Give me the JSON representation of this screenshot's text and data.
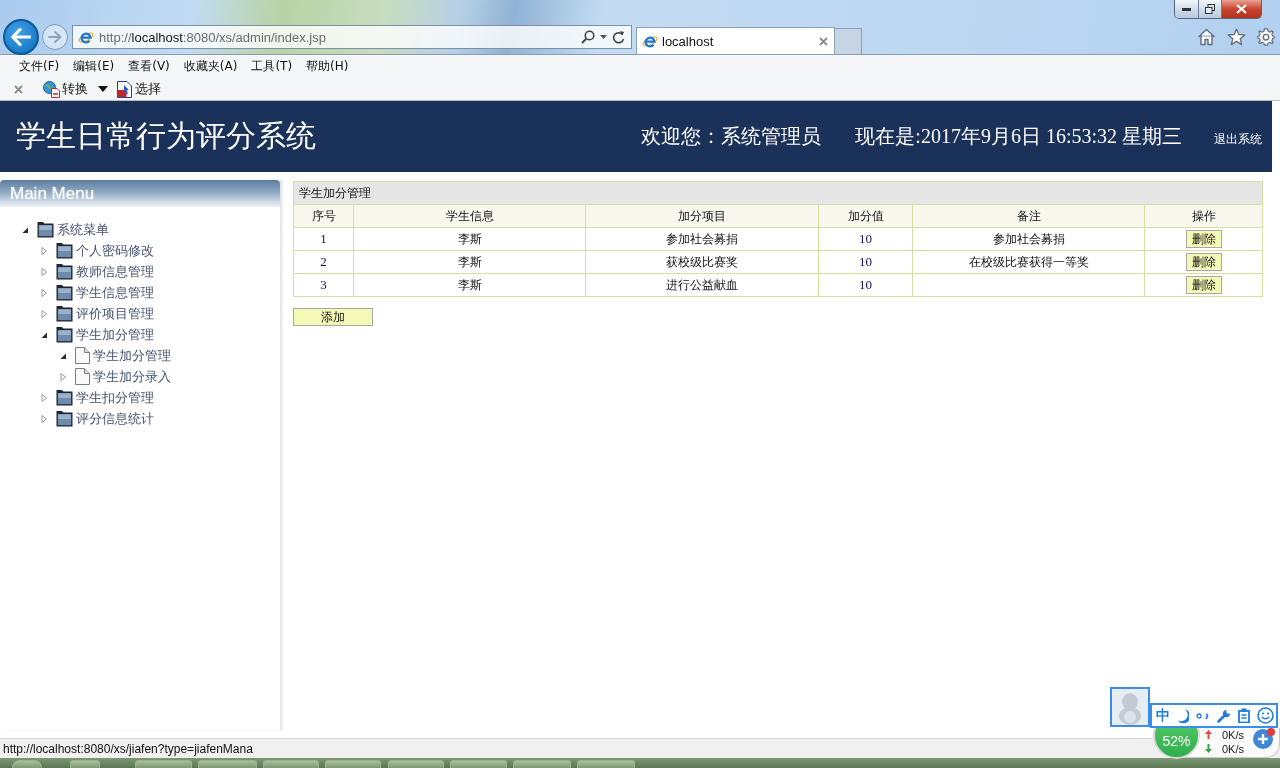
{
  "browser": {
    "address": "http://**localhost**:8080/xs/admin/index.jsp",
    "tabs": [
      {
        "title": "localhost",
        "selected": true
      }
    ],
    "menu": [
      "文件(F)",
      "编辑(E)",
      "查看(V)",
      "收藏夹(A)",
      "工具(T)",
      "帮助(H)"
    ],
    "toolbar": [
      {
        "kind": "convert",
        "label": "转换",
        "dropdown": true
      },
      {
        "kind": "select",
        "label": "选择",
        "dropdown": false
      }
    ]
  },
  "header": {
    "title": "学生日常行为评分系统",
    "welcome": "欢迎您：系统管理员",
    "datetime": "现在是:2017年9月6日 16:53:32 星期三",
    "logout": "退出系统"
  },
  "sidebar": {
    "title": "Main Menu",
    "tree": [
      {
        "label": "系统菜单",
        "kind": "folder",
        "expanded": true,
        "children": [
          {
            "label": "个人密码修改",
            "kind": "folder",
            "expanded": false
          },
          {
            "label": "教师信息管理",
            "kind": "folder",
            "expanded": false
          },
          {
            "label": "学生信息管理",
            "kind": "folder",
            "expanded": false
          },
          {
            "label": "评价项目管理",
            "kind": "folder",
            "expanded": false
          },
          {
            "label": "学生加分管理",
            "kind": "folder",
            "expanded": true,
            "children": [
              {
                "label": "学生加分管理",
                "kind": "file",
                "expanded": true
              },
              {
                "label": "学生加分录入",
                "kind": "file",
                "expanded": false
              }
            ]
          },
          {
            "label": "学生扣分管理",
            "kind": "folder",
            "expanded": false
          },
          {
            "label": "评分信息统计",
            "kind": "folder",
            "expanded": false
          }
        ]
      }
    ]
  },
  "panel": {
    "title": "学生加分管理",
    "columns": [
      "序号",
      "学生信息",
      "加分项目",
      "加分值",
      "备注",
      "操作"
    ],
    "rows": [
      {
        "no": "1",
        "student": "李斯",
        "item": "参加社会募捐",
        "points": "10",
        "note": "参加社会募捐",
        "action": "删除"
      },
      {
        "no": "2",
        "student": "李斯",
        "item": "获校级比赛奖",
        "points": "10",
        "note": "在校级比赛获得一等奖",
        "action": "删除"
      },
      {
        "no": "3",
        "student": "李斯",
        "item": "进行公益献血",
        "points": "10",
        "action": "删除"
      }
    ],
    "add_button": "添加"
  },
  "status_bar": {
    "text": "http://localhost:8080/xs/jiafen?type=jiafenMana"
  },
  "tray": {
    "ime_mode": "中",
    "memory": "52%",
    "upload": "0K/s",
    "download": "0K/s"
  }
}
